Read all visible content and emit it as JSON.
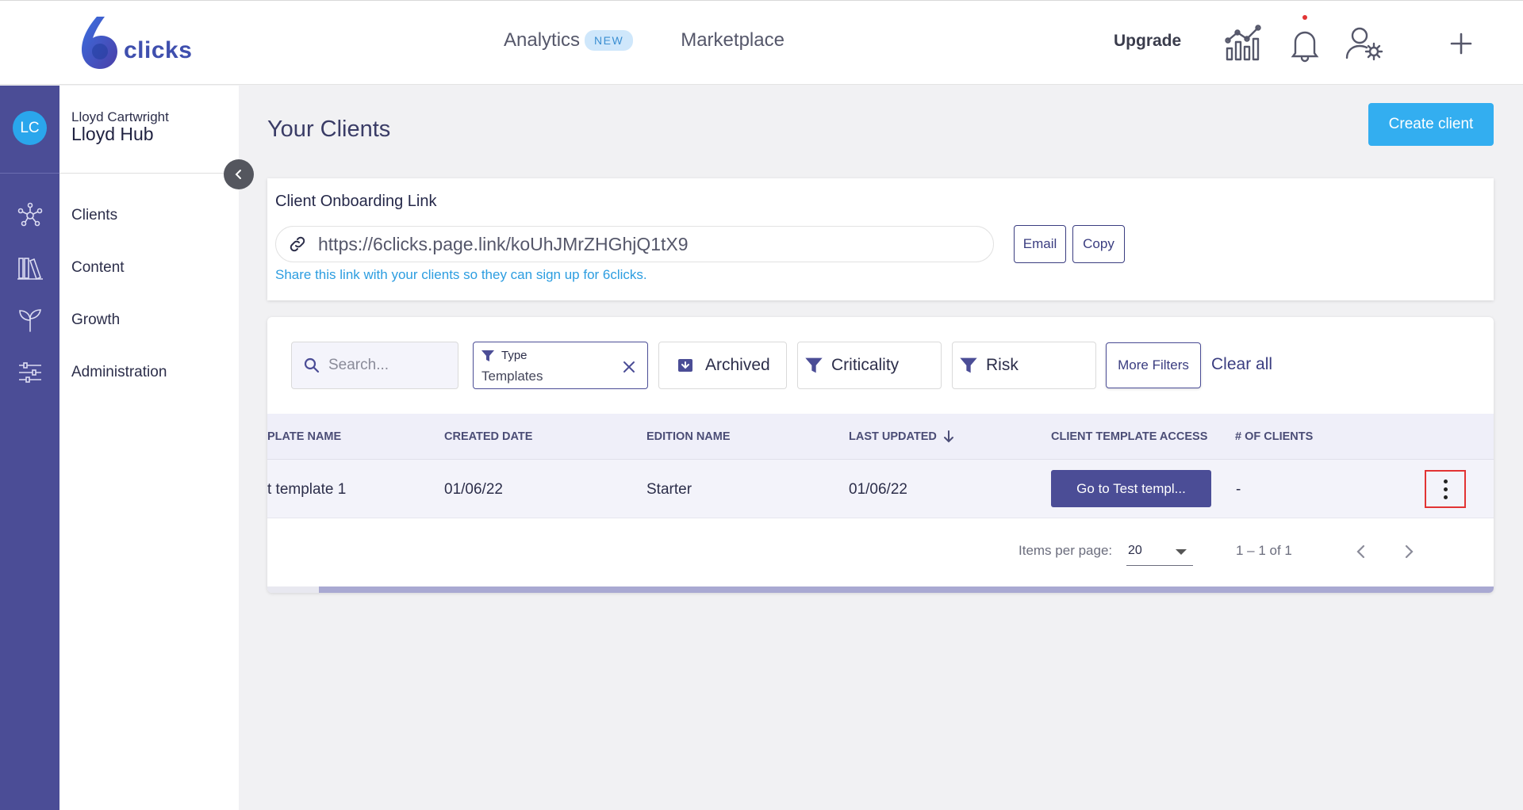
{
  "header": {
    "logo_text": "clicks",
    "nav": [
      {
        "label": "Analytics",
        "badge": "NEW"
      },
      {
        "label": "Marketplace"
      }
    ],
    "upgrade_label": "Upgrade",
    "icons": [
      "analytics-chart-icon",
      "bell-icon",
      "user-settings-icon",
      "plus-icon"
    ]
  },
  "sidebar": {
    "avatar_initials": "LC",
    "user_name": "Lloyd Cartwright",
    "hub_name": "Lloyd Hub",
    "items": [
      {
        "label": "Clients",
        "icon": "network-icon"
      },
      {
        "label": "Content",
        "icon": "library-icon"
      },
      {
        "label": "Growth",
        "icon": "sprout-icon"
      },
      {
        "label": "Administration",
        "icon": "sliders-icon"
      }
    ]
  },
  "main": {
    "title": "Your Clients",
    "create_button": "Create client",
    "onboarding": {
      "heading": "Client Onboarding Link",
      "url": "https://6clicks.page.link/koUhJMrZHGhjQ1tX9",
      "email_button": "Email",
      "copy_button": "Copy",
      "hint": "Share this link with your clients so they can sign up for 6clicks."
    },
    "filters": {
      "search_placeholder": "Search...",
      "type_label": "Type",
      "type_value": "Templates",
      "archived": "Archived",
      "criticality": "Criticality",
      "risk": "Risk",
      "more_filters": "More Filters",
      "clear_all": "Clear all"
    },
    "table": {
      "columns": [
        "PLATE NAME",
        "CREATED DATE",
        "EDITION NAME",
        "LAST UPDATED",
        "CLIENT TEMPLATE ACCESS",
        "# OF CLIENTS"
      ],
      "rows": [
        {
          "name": "t template 1",
          "created": "01/06/22",
          "edition": "Starter",
          "updated": "01/06/22",
          "access_button": "Go to Test templ...",
          "clients": "-"
        }
      ]
    },
    "pagination": {
      "items_per_page_label": "Items per page:",
      "items_per_page": "20",
      "range": "1 – 1 of 1"
    }
  }
}
